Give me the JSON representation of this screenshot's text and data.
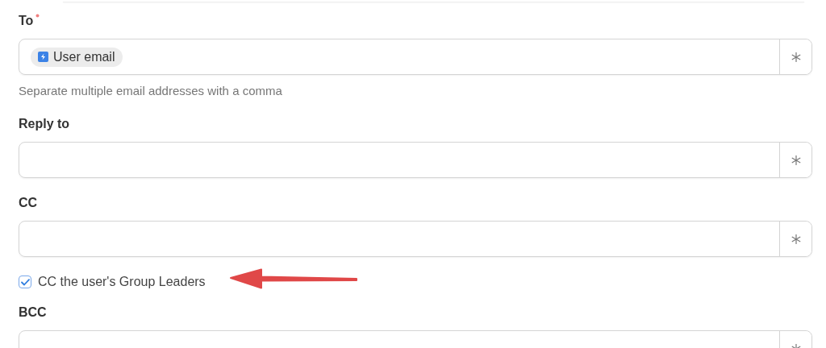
{
  "form": [
    {
      "kind": "field",
      "label": "To",
      "required": true,
      "tokens": [
        "User email"
      ],
      "hint": "Separate multiple email addresses with a comma"
    },
    {
      "kind": "field",
      "label": "Reply to",
      "required": false
    },
    {
      "kind": "field",
      "label": "CC",
      "required": false
    },
    {
      "kind": "checkbox",
      "label": "CC the user's Group Leaders",
      "checked": true
    },
    {
      "kind": "field",
      "label": "BCC",
      "required": false
    }
  ]
}
